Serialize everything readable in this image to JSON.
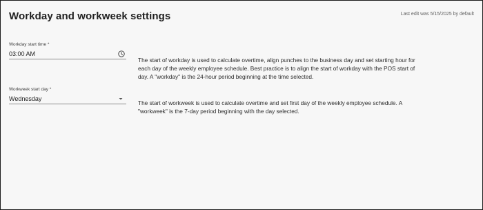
{
  "header": {
    "title": "Workday and workweek settings",
    "last_edit": "Last edit was 5/15/2025 by default"
  },
  "workday": {
    "label": "Workday start time *",
    "value": "03:00 AM",
    "icon": "clock-icon",
    "description": "The start of workday is used to calculate overtime, align punches to the business day and set starting hour for each day of the weekly employee schedule. Best practice is to align the start of workday with the POS start of day. A \"workday\" is the 24-hour period beginning at the time selected."
  },
  "workweek": {
    "label": "Workweek start day *",
    "value": "Wednesday",
    "icon": "chevron-down-icon",
    "description": "The start of workweek is used to calculate overtime and set first day of the weekly employee schedule. A \"workweek\" is the 7-day period beginning with the day selected."
  }
}
